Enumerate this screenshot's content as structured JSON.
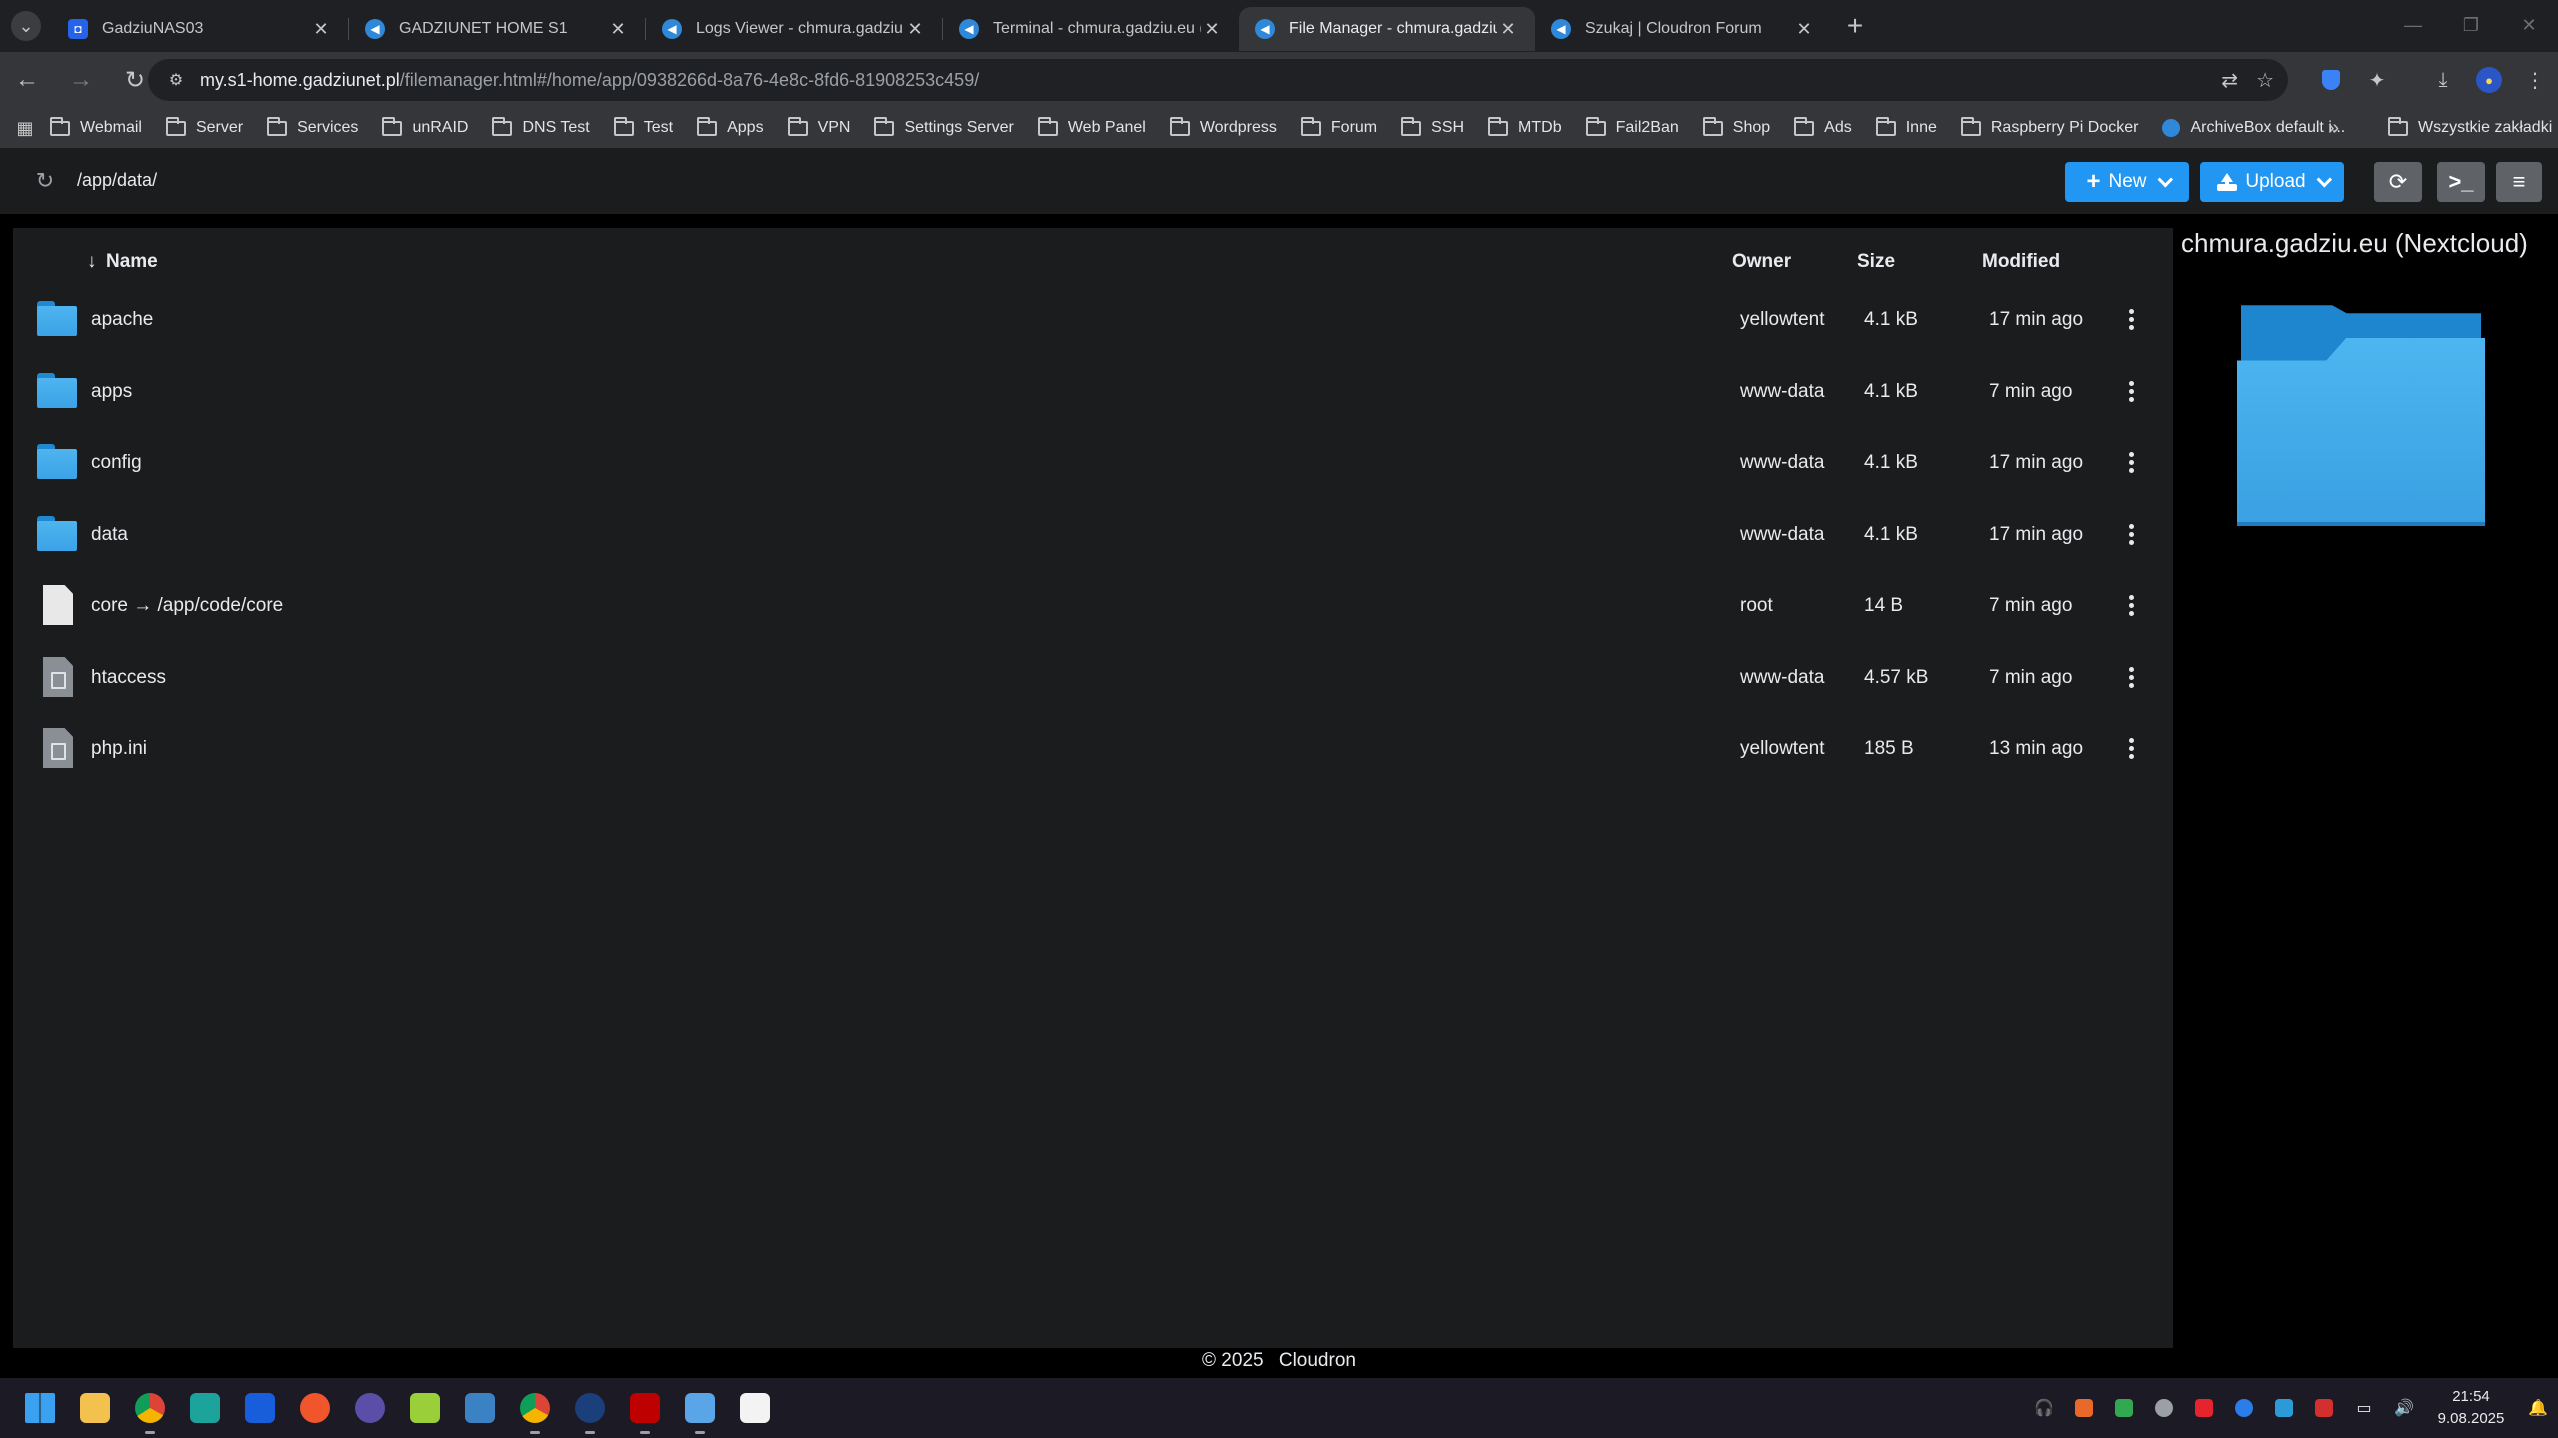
{
  "browser": {
    "tabs": [
      {
        "title": "GadziuNAS03",
        "active": false
      },
      {
        "title": "GADZIUNET HOME S1",
        "active": false
      },
      {
        "title": "Logs Viewer - chmura.gadziu.eu",
        "active": false
      },
      {
        "title": "Terminal - chmura.gadziu.eu (N",
        "active": false
      },
      {
        "title": "File Manager - chmura.gadziu.eu",
        "active": true
      },
      {
        "title": "Szukaj | Cloudron Forum",
        "active": false
      }
    ],
    "url_host": "my.s1-home.gadziunet.pl",
    "url_path": "/filemanager.html#/home/app/0938266d-8a76-4e8c-8fd6-81908253c459/",
    "bookmarks": [
      "Webmail",
      "Server",
      "Services",
      "unRAID",
      "DNS Test",
      "Test",
      "Apps",
      "VPN",
      "Settings Server",
      "Web Panel",
      "Wordpress",
      "Forum",
      "SSH",
      "MTDb",
      "Fail2Ban",
      "Shop",
      "Ads",
      "Inne",
      "Raspberry Pi Docker",
      "ArchiveBox default i..."
    ],
    "all_bookmarks_label": "Wszystkie zakładki",
    "more_bookmarks_glyph": "»"
  },
  "filemanager": {
    "current_path": "/app/data/",
    "new_label": "New",
    "upload_label": "Upload",
    "columns": {
      "name": "Name",
      "owner": "Owner",
      "size": "Size",
      "modified": "Modified",
      "sort_glyph": "↓"
    },
    "rows": [
      {
        "icon": "folder-icon",
        "name": "apache",
        "owner": "yellowtent",
        "size": "4.1 kB",
        "modified": "17 min ago"
      },
      {
        "icon": "folder-icon",
        "name": "apps",
        "owner": "www-data",
        "size": "4.1 kB",
        "modified": "7 min ago"
      },
      {
        "icon": "folder-icon",
        "name": "config",
        "owner": "www-data",
        "size": "4.1 kB",
        "modified": "17 min ago"
      },
      {
        "icon": "folder-icon",
        "name": "data",
        "owner": "www-data",
        "size": "4.1 kB",
        "modified": "17 min ago"
      },
      {
        "icon": "file-icon",
        "name": "core → /app/code/core",
        "owner": "root",
        "size": "14 B",
        "modified": "7 min ago"
      },
      {
        "icon": "text-file-icon",
        "name": "htaccess",
        "owner": "www-data",
        "size": "4.57 kB",
        "modified": "7 min ago"
      },
      {
        "icon": "text-file-icon",
        "name": "php.ini",
        "owner": "yellowtent",
        "size": "185 B",
        "modified": "13 min ago"
      }
    ],
    "preview_title": "chmura.gadziu.eu (Nextcloud)",
    "footer_copyright": "© 2025",
    "footer_brand": "Cloudron"
  },
  "taskbar": {
    "time": "21:54",
    "date": "9.08.2025"
  },
  "colors": {
    "accent": "#2196f3",
    "folder": "#3aa3e6",
    "panel": "#1b1c1e"
  }
}
